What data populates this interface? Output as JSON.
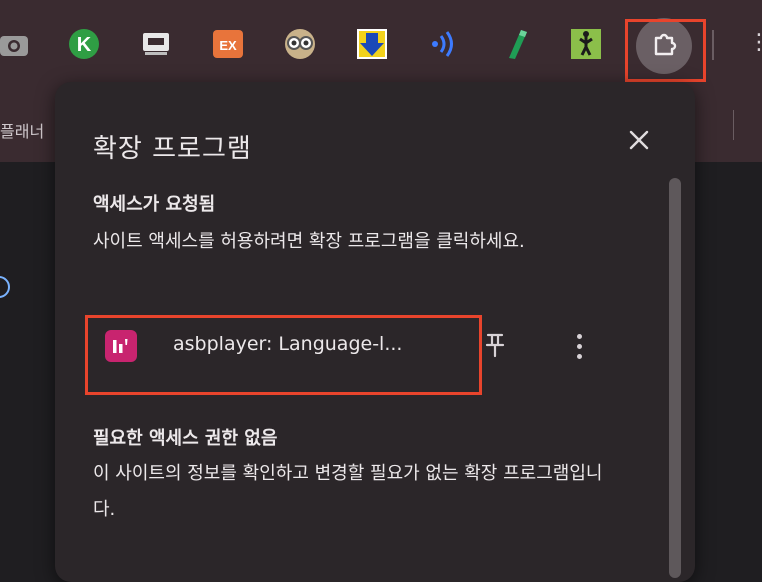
{
  "bookmark": {
    "partial_text": "플래너"
  },
  "toolbar": {
    "extensions_icon": "puzzle-icon",
    "menu_glyph": "⋮"
  },
  "popup": {
    "title": "확장 프로그램",
    "close_glyph": "✕",
    "access_requested": {
      "heading": "액세스가 요청됨",
      "description": "사이트 액세스를 허용하려면 확장 프로그램을 클릭하세요.",
      "extension": {
        "name": "asbplayer: Language-l...",
        "logo_text": "ıl'"
      }
    },
    "no_access": {
      "heading": "필요한 액세스 권한 없음",
      "description": "이 사이트의 정보를 확인하고 변경할 필요가 없는 확장 프로그램입니다."
    }
  },
  "colors": {
    "toolbar_bg": "#3a2b30",
    "popup_bg": "#2b2629",
    "highlight": "#e8442c",
    "asbplayer_brand": "#c8246f"
  }
}
